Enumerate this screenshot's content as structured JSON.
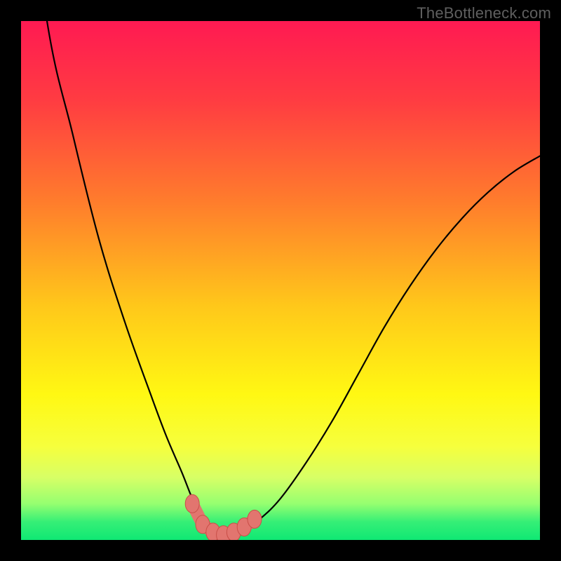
{
  "watermark": "TheBottleneck.com",
  "colors": {
    "black": "#000000",
    "curve": "#000000",
    "marker_fill": "#e2756f",
    "marker_stroke": "#c94f48",
    "gradient_stops": [
      {
        "offset": 0.0,
        "color": "#ff1a52"
      },
      {
        "offset": 0.15,
        "color": "#ff3b42"
      },
      {
        "offset": 0.35,
        "color": "#ff7d2c"
      },
      {
        "offset": 0.55,
        "color": "#ffc81a"
      },
      {
        "offset": 0.72,
        "color": "#fff813"
      },
      {
        "offset": 0.82,
        "color": "#f6ff3d"
      },
      {
        "offset": 0.88,
        "color": "#d7ff66"
      },
      {
        "offset": 0.93,
        "color": "#96ff70"
      },
      {
        "offset": 0.965,
        "color": "#36ef76"
      },
      {
        "offset": 1.0,
        "color": "#0fe874"
      }
    ]
  },
  "chart_data": {
    "type": "line",
    "title": "",
    "xlabel": "",
    "ylabel": "",
    "xlim": [
      0,
      100
    ],
    "ylim": [
      0,
      100
    ],
    "note": "V-shaped bottleneck curve. y≈0 (green) is optimal; y→100 (red) is severe bottleneck. Minimum plateau around x≈35–43.",
    "x": [
      0,
      5,
      10,
      15,
      20,
      25,
      28,
      31,
      33,
      35,
      37,
      39,
      41,
      43,
      46,
      50,
      55,
      60,
      65,
      70,
      75,
      80,
      85,
      90,
      95,
      100
    ],
    "y": [
      140,
      100,
      78,
      58,
      42,
      28,
      20,
      13,
      8,
      4,
      2,
      1,
      1,
      2,
      4,
      8,
      15,
      23,
      32,
      41,
      49,
      56,
      62,
      67,
      71,
      74
    ],
    "markers": {
      "x": [
        33,
        35,
        37,
        39,
        41,
        43,
        45
      ],
      "y": [
        7,
        3,
        1.5,
        1,
        1.5,
        2.5,
        4
      ]
    }
  }
}
